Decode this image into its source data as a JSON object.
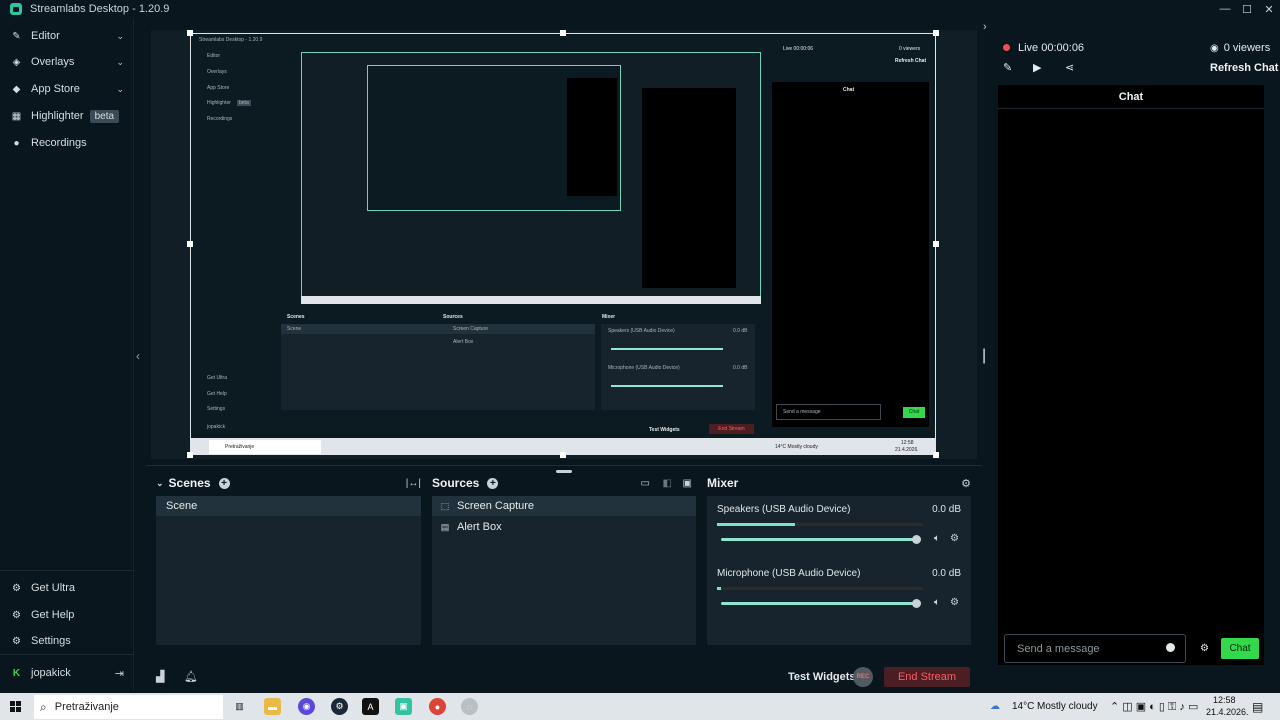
{
  "window": {
    "title": "Streamlabs Desktop - 1.20.9",
    "controls": [
      "—",
      "☐",
      "✕"
    ]
  },
  "nav": {
    "items": [
      {
        "label": "Editor",
        "icon": "pencil-icon"
      },
      {
        "label": "Overlays",
        "icon": "paint-icon"
      },
      {
        "label": "App Store",
        "icon": "store-icon"
      },
      {
        "label": "Highlighter",
        "icon": "highlighter-icon",
        "badge": "beta"
      },
      {
        "label": "Recordings",
        "icon": "record-icon"
      }
    ],
    "bottom": [
      {
        "label": "Get Ultra",
        "icon": "ultra-icon"
      },
      {
        "label": "Get Help",
        "icon": "help-icon"
      },
      {
        "label": "Settings",
        "icon": "gear-icon"
      }
    ],
    "user": {
      "name": "jopakick",
      "logout_icon": "logout-icon"
    }
  },
  "preview": {
    "nested_title": "Streamlabs Desktop - 1.20.9",
    "nested_nav": [
      "Editor",
      "Overlays",
      "App Store",
      "Highlighter",
      "Recordings"
    ],
    "nested_badge": "beta",
    "nested_bottom": [
      "Get Ultra",
      "Get Help",
      "Settings"
    ],
    "nested_user": "jopakick",
    "nested_scenes": "Scenes",
    "nested_scene": "Scene",
    "nested_sources": "Sources",
    "nested_source_1": "Screen Capture",
    "nested_source_2": "Alert Box",
    "nested_mixer": "Mixer",
    "nested_speakers": "Speakers (USB Audio Device)",
    "nested_mic": "Microphone (USB Audio Device)",
    "nested_db": "0.0 dB",
    "nested_test": "Test Widgets",
    "nested_end": "End Stream",
    "nested_live": "Live 00:00:06",
    "nested_viewers": "0 viewers",
    "nested_refresh": "Refresh Chat",
    "nested_chat": "Chat",
    "nested_send": "Send a message",
    "nested_chat_btn": "Chat",
    "nested_search": "Pretraživanje",
    "nested_weather": "14°C  Mostly cloudy",
    "nested_time": "12:58",
    "nested_date": "21.4.2026."
  },
  "scenes": {
    "title": "Scenes",
    "items": [
      "Scene"
    ]
  },
  "sources": {
    "title": "Sources",
    "items": [
      "Screen Capture",
      "Alert Box"
    ]
  },
  "mixer": {
    "title": "Mixer",
    "channels": [
      {
        "name": "Speakers (USB Audio Device)",
        "db": "0.0 dB",
        "level": 0.38,
        "volume": 1.0
      },
      {
        "name": "Microphone (USB Audio Device)",
        "db": "0.0 dB",
        "level": 0.02,
        "volume": 1.0
      }
    ]
  },
  "footer": {
    "test_widgets": "Test Widgets",
    "rec_label": "REC",
    "end_stream": "End Stream"
  },
  "chat": {
    "live": "Live 00:00:06",
    "viewers": "0 viewers",
    "refresh": "Refresh Chat",
    "title": "Chat",
    "placeholder": "Send a message",
    "send": "Chat"
  },
  "taskbar": {
    "search": "Pretraživanje",
    "weather": "14°C",
    "weather_desc": "Mostly cloudy",
    "time": "12:58",
    "date": "21.4.2026."
  },
  "colors": {
    "accent": "#31c3a2",
    "live": "#f54b4b",
    "send": "#34d84b",
    "end_stream": "#ff5b64"
  }
}
